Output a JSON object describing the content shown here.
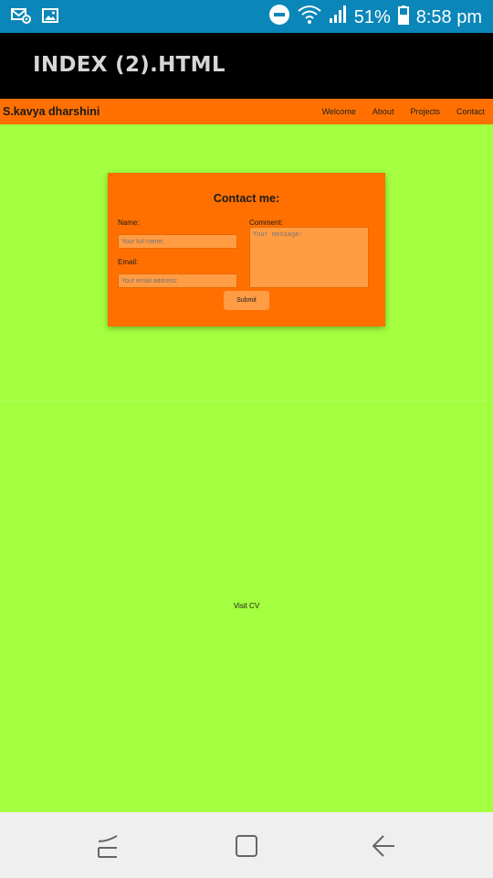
{
  "status_bar": {
    "battery": "51%",
    "time": "8:58 pm",
    "bg_color": "#0a86b8"
  },
  "app_bar": {
    "title": "INDEX (2).HTML"
  },
  "site": {
    "brand": "S.kavya dharshini",
    "nav": [
      "Welcome",
      "About",
      "Projects",
      "Contact"
    ],
    "accent_color": "#ff7000",
    "page_bg": "#a3ff3f"
  },
  "contact_form": {
    "title": "Contact me:",
    "name_label": "Name:",
    "name_placeholder": "Your full name:",
    "email_label": "Email:",
    "email_placeholder": "Your email address:",
    "comment_label": "Comment:",
    "comment_placeholder": "Your message:",
    "submit_label": "Submit"
  },
  "footer": {
    "link_label": "Visit CV"
  },
  "icons": {
    "status_left": [
      "mail-settings-icon",
      "image-icon"
    ],
    "status_right": [
      "do-not-disturb-icon",
      "wifi-icon",
      "signal-icon",
      "battery-icon"
    ],
    "system_nav": [
      "recents-icon",
      "home-icon",
      "back-icon"
    ]
  }
}
